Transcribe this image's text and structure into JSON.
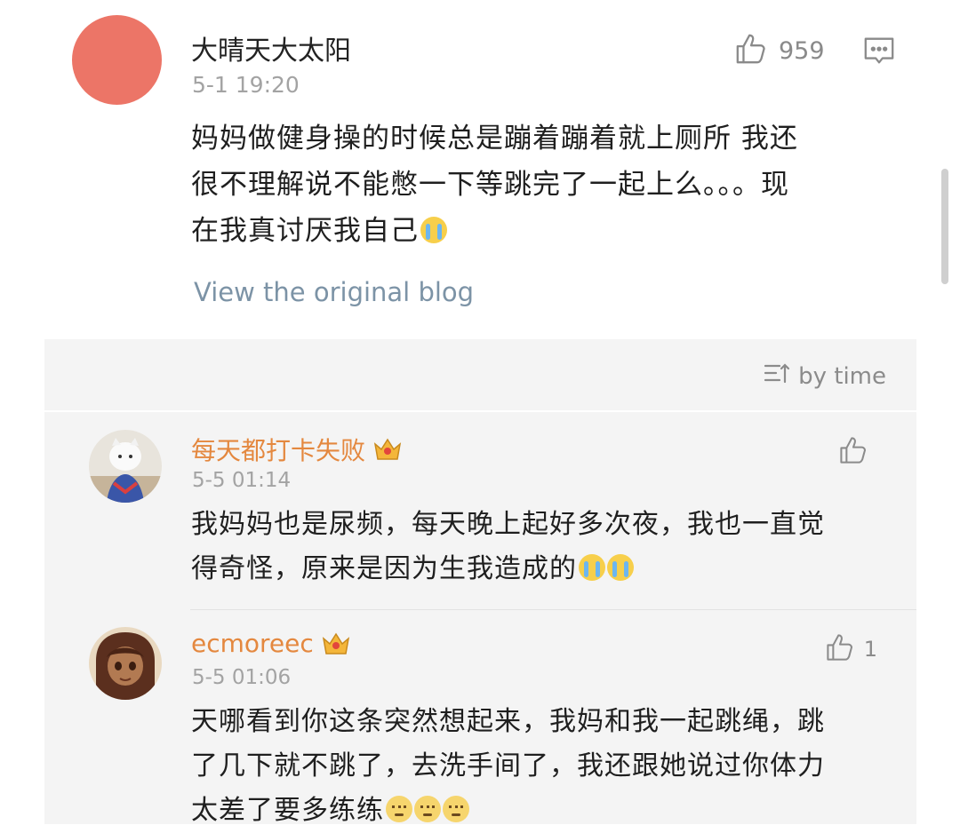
{
  "post": {
    "author": "大晴天大太阳",
    "date": "5-1 19:20",
    "likes": "959",
    "text_lines": [
      "妈妈做健身操的时候总是蹦着蹦着就上厕所 我还",
      "很不理解说不能憋一下等跳完了一起上么。。。现",
      "在我真讨厌我自己"
    ],
    "view_original": "View the original blog",
    "icons": {
      "like": "thumbs-up-icon",
      "comment": "comment-icon",
      "emoji": "crying-emoji-icon"
    },
    "colors": {
      "avatar": "#ec7567",
      "link": "#7c93a6"
    }
  },
  "comments_panel": {
    "sort_label": "by time",
    "sort_icon": "sort-icon",
    "comments": [
      {
        "author": "每天都打卡失败",
        "date": "5-5 01:14",
        "likes": "",
        "text_lines": [
          "我妈妈也是尿频，每天晚上起好多次夜，我也一直觉",
          "得奇怪，原来是因为生我造成的"
        ],
        "badge_icon": "crown-icon",
        "emoji_icon": "crying-emoji-icon"
      },
      {
        "author": "ecmoreec",
        "date": "5-5 01:06",
        "likes": "1",
        "text_lines": [
          "天哪看到你这条突然想起来，我妈和我一起跳绳，跳",
          "了几下就不跳了，去洗手间了，我还跟她说过你体力",
          "太差了要多练练"
        ],
        "badge_icon": "crown-icon",
        "emoji_icon": "speechless-emoji-icon"
      }
    ],
    "colors": {
      "username": "#e4883f",
      "background": "#f4f4f4"
    }
  }
}
